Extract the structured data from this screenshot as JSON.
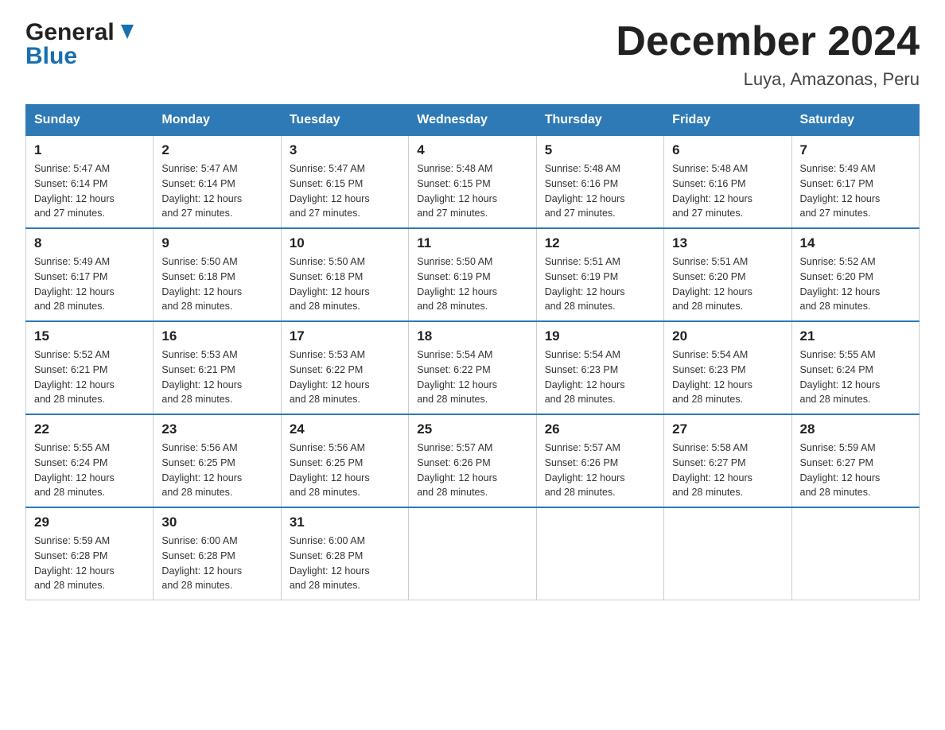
{
  "header": {
    "logo_line1": "General",
    "logo_line2": "Blue",
    "title": "December 2024",
    "subtitle": "Luya, Amazonas, Peru"
  },
  "weekdays": [
    "Sunday",
    "Monday",
    "Tuesday",
    "Wednesday",
    "Thursday",
    "Friday",
    "Saturday"
  ],
  "weeks": [
    [
      {
        "day": "1",
        "sunrise": "5:47 AM",
        "sunset": "6:14 PM",
        "daylight": "12 hours and 27 minutes."
      },
      {
        "day": "2",
        "sunrise": "5:47 AM",
        "sunset": "6:14 PM",
        "daylight": "12 hours and 27 minutes."
      },
      {
        "day": "3",
        "sunrise": "5:47 AM",
        "sunset": "6:15 PM",
        "daylight": "12 hours and 27 minutes."
      },
      {
        "day": "4",
        "sunrise": "5:48 AM",
        "sunset": "6:15 PM",
        "daylight": "12 hours and 27 minutes."
      },
      {
        "day": "5",
        "sunrise": "5:48 AM",
        "sunset": "6:16 PM",
        "daylight": "12 hours and 27 minutes."
      },
      {
        "day": "6",
        "sunrise": "5:48 AM",
        "sunset": "6:16 PM",
        "daylight": "12 hours and 27 minutes."
      },
      {
        "day": "7",
        "sunrise": "5:49 AM",
        "sunset": "6:17 PM",
        "daylight": "12 hours and 27 minutes."
      }
    ],
    [
      {
        "day": "8",
        "sunrise": "5:49 AM",
        "sunset": "6:17 PM",
        "daylight": "12 hours and 28 minutes."
      },
      {
        "day": "9",
        "sunrise": "5:50 AM",
        "sunset": "6:18 PM",
        "daylight": "12 hours and 28 minutes."
      },
      {
        "day": "10",
        "sunrise": "5:50 AM",
        "sunset": "6:18 PM",
        "daylight": "12 hours and 28 minutes."
      },
      {
        "day": "11",
        "sunrise": "5:50 AM",
        "sunset": "6:19 PM",
        "daylight": "12 hours and 28 minutes."
      },
      {
        "day": "12",
        "sunrise": "5:51 AM",
        "sunset": "6:19 PM",
        "daylight": "12 hours and 28 minutes."
      },
      {
        "day": "13",
        "sunrise": "5:51 AM",
        "sunset": "6:20 PM",
        "daylight": "12 hours and 28 minutes."
      },
      {
        "day": "14",
        "sunrise": "5:52 AM",
        "sunset": "6:20 PM",
        "daylight": "12 hours and 28 minutes."
      }
    ],
    [
      {
        "day": "15",
        "sunrise": "5:52 AM",
        "sunset": "6:21 PM",
        "daylight": "12 hours and 28 minutes."
      },
      {
        "day": "16",
        "sunrise": "5:53 AM",
        "sunset": "6:21 PM",
        "daylight": "12 hours and 28 minutes."
      },
      {
        "day": "17",
        "sunrise": "5:53 AM",
        "sunset": "6:22 PM",
        "daylight": "12 hours and 28 minutes."
      },
      {
        "day": "18",
        "sunrise": "5:54 AM",
        "sunset": "6:22 PM",
        "daylight": "12 hours and 28 minutes."
      },
      {
        "day": "19",
        "sunrise": "5:54 AM",
        "sunset": "6:23 PM",
        "daylight": "12 hours and 28 minutes."
      },
      {
        "day": "20",
        "sunrise": "5:54 AM",
        "sunset": "6:23 PM",
        "daylight": "12 hours and 28 minutes."
      },
      {
        "day": "21",
        "sunrise": "5:55 AM",
        "sunset": "6:24 PM",
        "daylight": "12 hours and 28 minutes."
      }
    ],
    [
      {
        "day": "22",
        "sunrise": "5:55 AM",
        "sunset": "6:24 PM",
        "daylight": "12 hours and 28 minutes."
      },
      {
        "day": "23",
        "sunrise": "5:56 AM",
        "sunset": "6:25 PM",
        "daylight": "12 hours and 28 minutes."
      },
      {
        "day": "24",
        "sunrise": "5:56 AM",
        "sunset": "6:25 PM",
        "daylight": "12 hours and 28 minutes."
      },
      {
        "day": "25",
        "sunrise": "5:57 AM",
        "sunset": "6:26 PM",
        "daylight": "12 hours and 28 minutes."
      },
      {
        "day": "26",
        "sunrise": "5:57 AM",
        "sunset": "6:26 PM",
        "daylight": "12 hours and 28 minutes."
      },
      {
        "day": "27",
        "sunrise": "5:58 AM",
        "sunset": "6:27 PM",
        "daylight": "12 hours and 28 minutes."
      },
      {
        "day": "28",
        "sunrise": "5:59 AM",
        "sunset": "6:27 PM",
        "daylight": "12 hours and 28 minutes."
      }
    ],
    [
      {
        "day": "29",
        "sunrise": "5:59 AM",
        "sunset": "6:28 PM",
        "daylight": "12 hours and 28 minutes."
      },
      {
        "day": "30",
        "sunrise": "6:00 AM",
        "sunset": "6:28 PM",
        "daylight": "12 hours and 28 minutes."
      },
      {
        "day": "31",
        "sunrise": "6:00 AM",
        "sunset": "6:28 PM",
        "daylight": "12 hours and 28 minutes."
      },
      null,
      null,
      null,
      null
    ]
  ],
  "labels": {
    "sunrise": "Sunrise:",
    "sunset": "Sunset:",
    "daylight": "Daylight:"
  }
}
